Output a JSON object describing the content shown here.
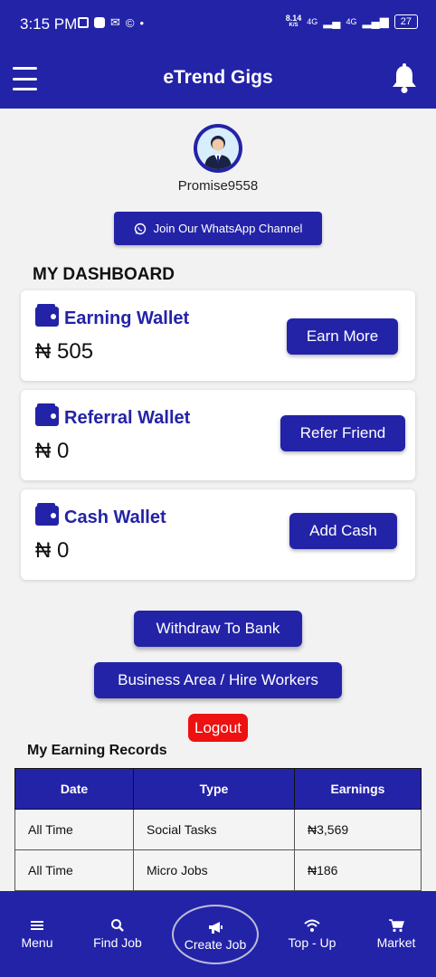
{
  "status_bar": {
    "time": "3:15 PM",
    "network_speed": "8.14",
    "network_speed_unit": "K/S",
    "signal_1": "4G",
    "signal_2": "4G",
    "battery": "27"
  },
  "app_bar": {
    "title": "eTrend Gigs"
  },
  "profile": {
    "username": "Promise9558"
  },
  "whatsapp_button": {
    "label": "Join Our WhatsApp Channel"
  },
  "dashboard": {
    "title": "MY DASHBOARD",
    "wallets": [
      {
        "name": "Earning Wallet",
        "amount": "₦ 505",
        "button": "Earn More"
      },
      {
        "name": "Referral Wallet",
        "amount": "₦ 0",
        "button": "Refer Friend"
      },
      {
        "name": "Cash Wallet",
        "amount": "₦ 0",
        "button": "Add Cash"
      }
    ]
  },
  "actions": {
    "withdraw": "Withdraw To Bank",
    "business": "Business Area / Hire Workers",
    "logout": "Logout"
  },
  "records": {
    "title": "My Earning Records",
    "columns": [
      "Date",
      "Type",
      "Earnings"
    ],
    "rows": [
      [
        "All Time",
        "Social Tasks",
        "₦3,569"
      ],
      [
        "All Time",
        "Micro Jobs",
        "₦186"
      ]
    ]
  },
  "bottom_nav": {
    "menu": "Menu",
    "find_job": "Find Job",
    "create_job": "Create Job",
    "top_up": "Top - Up",
    "market": "Market"
  },
  "colors": {
    "primary": "#2323a8",
    "logout": "#ee1111",
    "background": "#f2f2f2"
  }
}
